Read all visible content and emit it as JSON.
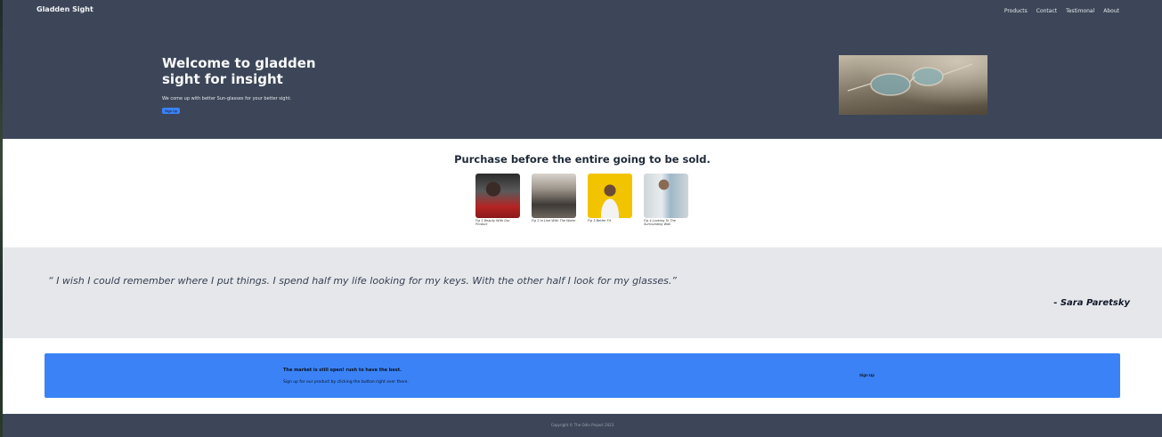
{
  "header": {
    "brand": "Gladden Sight",
    "nav": [
      "Products",
      "Contact",
      "Testimonal",
      "About"
    ]
  },
  "hero": {
    "title": "Welcome to gladden sight for insight",
    "subtitle": "We come up with better Sun-glasses for your better sight.",
    "button_label": "Sign Up"
  },
  "products": {
    "title": "Purchase before the entire going to be sold.",
    "items": [
      {
        "caption": "Fig 1 Beauty With Our Product"
      },
      {
        "caption": "Fig 2 In Line With The Warm"
      },
      {
        "caption": "Fig 3 Better Fit"
      },
      {
        "caption": "Fig 4 Looking To The Surrounding Wall"
      }
    ]
  },
  "testimonial": {
    "quote": "“ I wish I could remember where I put things. I spend half my life looking for my keys. With the other half I look for my glasses.”",
    "author": "- Sara Paretsky"
  },
  "cta": {
    "title": "The market is still open! rush to have the best.",
    "subtitle": "Sign up for our product by clicking the button right over there.",
    "button_label": "Sign Up"
  },
  "footer": {
    "copyright": "Copyright © The Odin Project 2023"
  },
  "colors": {
    "dark_bg": "#3c4658",
    "accent": "#3b82f6",
    "quote_bg": "#e5e7eb"
  }
}
